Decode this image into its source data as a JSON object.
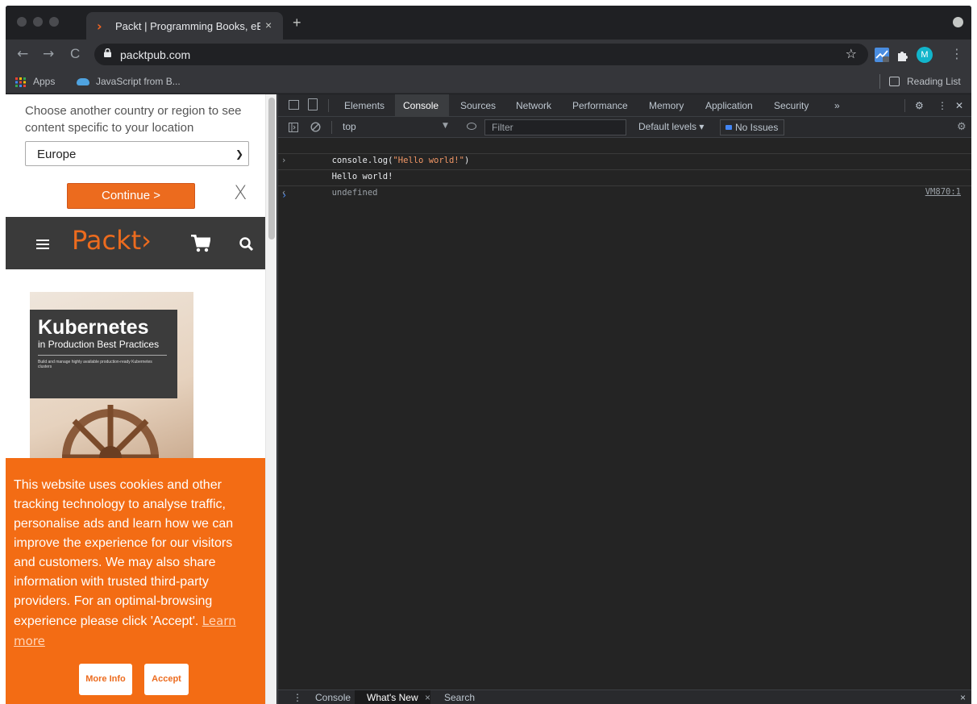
{
  "browser": {
    "tab_title": "Packt | Programming Books, eBooks & Videos for Developers",
    "tab_close": "×",
    "new_tab": "+",
    "url": "packtpub.com",
    "nav": {
      "back": "←",
      "forward": "→",
      "reload": "C"
    },
    "star": "☆",
    "avatar_letter": "M",
    "menu": "⋮",
    "bookmarks": {
      "apps": "Apps",
      "item1": "JavaScript from B...",
      "reading_list": "Reading List"
    }
  },
  "page": {
    "region_prompt": "Choose another country or region to see content specific to your location",
    "region_value": "Europe",
    "continue_label": "Continue >",
    "region_close": "X",
    "logo": "Packt›",
    "book": {
      "title": "Kubernetes",
      "subtitle": "in Production Best Practices",
      "desc": "Build and manage highly available production-ready Kubernetes clusters"
    },
    "cookie_text": "This website uses cookies and other tracking technology to analyse traffic, personalise ads and learn how we can improve the experience for our visitors and customers. We may also share information with trusted third-party providers. For an optimal-browsing experience please click 'Accept'.",
    "learn_more": "Learn more",
    "more_info": "More Info",
    "accept": "Accept"
  },
  "devtools": {
    "tabs": [
      "Elements",
      "Console",
      "Sources",
      "Network",
      "Performance",
      "Memory",
      "Application",
      "Security"
    ],
    "more_tabs": "»",
    "active_tab": "Console",
    "context": "top",
    "filter_placeholder": "Filter",
    "levels": "Default levels ▾",
    "issues": "No Issues",
    "console": {
      "input_fn": "console.log(",
      "input_str": "\"Hello world!\"",
      "input_close": ")",
      "output": "Hello world!",
      "source_link": "VM870:1",
      "return_value": "undefined"
    },
    "drawer_tabs": [
      "Console",
      "What's New",
      "Search"
    ],
    "drawer_close_small": "×",
    "drawer_close": "×"
  }
}
